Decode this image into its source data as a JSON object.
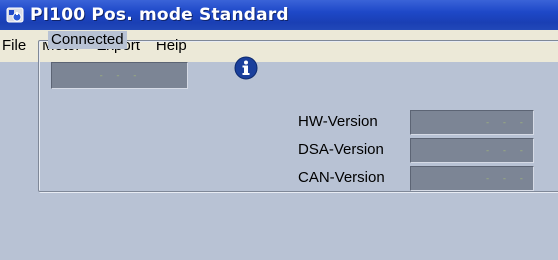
{
  "window": {
    "title": "PI100 Pos. mode Standard",
    "icon": "app-pi-icon"
  },
  "menu": {
    "items": [
      {
        "label": "File"
      },
      {
        "label": "Motor"
      },
      {
        "label": "Export"
      },
      {
        "label": "Help"
      }
    ]
  },
  "connection": {
    "group_label": "Connected",
    "status_value": "- - -"
  },
  "info_icon": "info-icon",
  "versions": [
    {
      "label": "HW-Version",
      "value": "- - -"
    },
    {
      "label": "DSA-Version",
      "value": "- - -"
    },
    {
      "label": "CAN-Version",
      "value": "- - -"
    }
  ],
  "colors": {
    "titlebar": "#1e48c8",
    "menubar": "#ece9d8",
    "background": "#b8c2d4",
    "field": "#7c8595",
    "led": "#9fb37a"
  }
}
